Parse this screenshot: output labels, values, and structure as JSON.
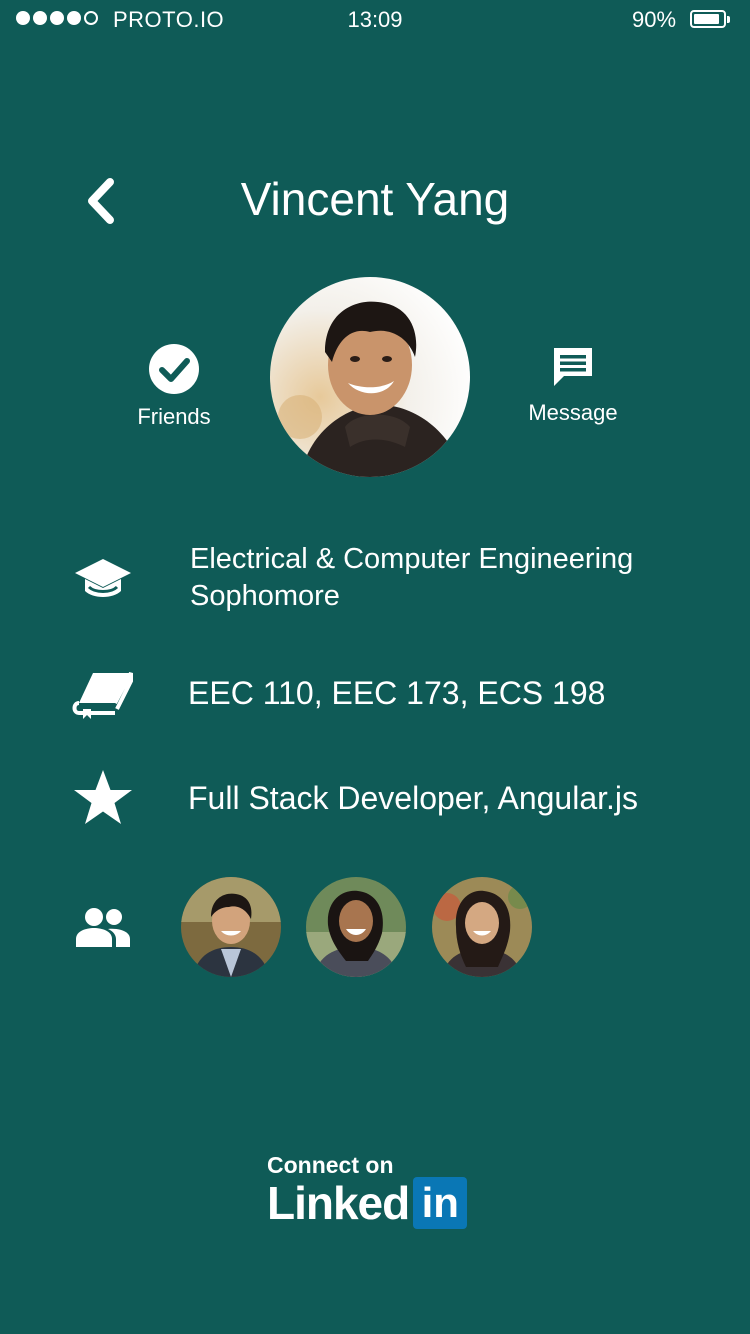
{
  "status_bar": {
    "signal_dots_filled": 4,
    "signal_dots_total": 5,
    "carrier": "PROTO.IO",
    "time": "13:09",
    "battery_percent": "90%",
    "battery_level": 0.9
  },
  "header": {
    "back_icon": "chevron-left-icon",
    "title": "Vincent Yang"
  },
  "profile": {
    "friends_label": "Friends",
    "friends_icon": "check-circle-icon",
    "message_label": "Message",
    "message_icon": "chat-bubble-icon",
    "avatar_icon": "profile-photo"
  },
  "info": {
    "education": {
      "icon": "graduation-cap-icon",
      "major": "Electrical & Computer Engineering",
      "year": "Sophomore"
    },
    "courses": {
      "icon": "book-icon",
      "text": "EEC 110, EEC 173, ECS 198"
    },
    "skills": {
      "icon": "star-icon",
      "text": "Full Stack Developer, Angular.js"
    },
    "friends": {
      "icon": "people-icon",
      "avatars": [
        "friend-photo-1",
        "friend-photo-2",
        "friend-photo-3"
      ]
    }
  },
  "footer": {
    "connect_on": "Connect on",
    "brand_word": "Linked",
    "brand_box": "in"
  },
  "colors": {
    "background": "#0f5b57",
    "text": "#ffffff",
    "linkedin_blue": "#0a77b5"
  }
}
